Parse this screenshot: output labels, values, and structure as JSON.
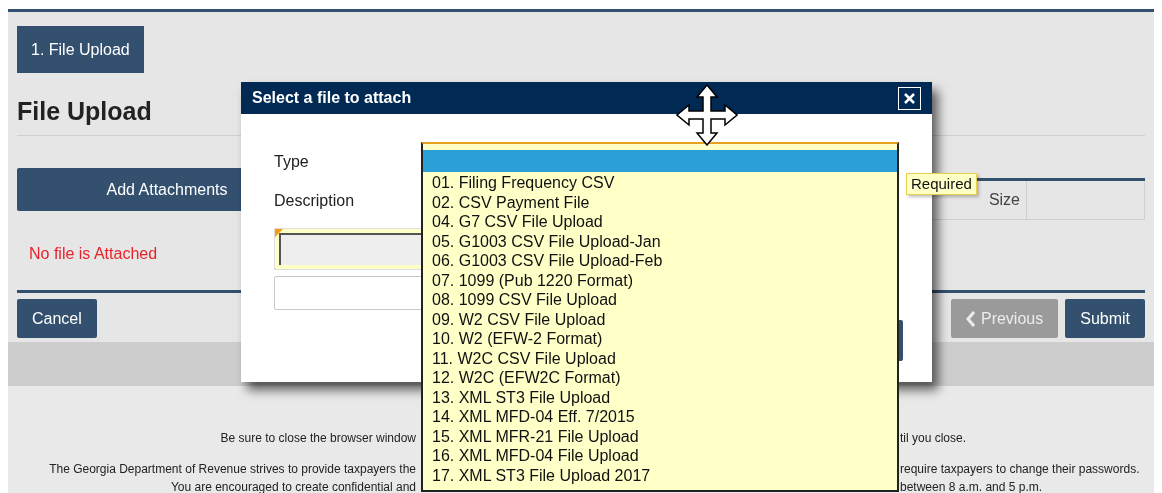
{
  "steps": [
    {
      "label": "1. File Upload",
      "selected": true
    }
  ],
  "page": {
    "heading": "File Upload",
    "add_button": "Add Attachments",
    "table": {
      "columns": [
        "Size"
      ]
    },
    "empty_message": "No file is Attached"
  },
  "buttons": [
    {
      "label": "Cancel",
      "kind": "plain",
      "disabled": false
    },
    {
      "label": "Previous",
      "kind": "back",
      "disabled": true
    },
    {
      "label": "Submit",
      "kind": "plain",
      "disabled": false
    }
  ],
  "footer": [
    {
      "left": "Be sure to close the browser window",
      "right": "til you close."
    },
    {
      "left": "The Georgia Department of Revenue strives to provide taxpayers the",
      "right": "require taxpayers to change their passwords."
    },
    {
      "left": "You are encouraged to create confidential and",
      "right": "between 8 a.m. and 5 p.m."
    }
  ],
  "dialog": {
    "title": "Select a file to attach",
    "fields": [
      {
        "label": "Type"
      },
      {
        "label": "Description"
      }
    ],
    "type_dropdown": {
      "tooltip": "Required",
      "options": [
        {
          "selected": true
        },
        {
          "label": "01. Filing Frequency CSV",
          "selected": false
        },
        {
          "label": "02. CSV Payment File",
          "selected": false
        },
        {
          "label": "04. G7 CSV File Upload",
          "selected": false
        },
        {
          "label": "05. G1003 CSV File Upload-Jan",
          "selected": false
        },
        {
          "label": "06. G1003 CSV File Upload-Feb",
          "selected": false
        },
        {
          "label": "07. 1099 (Pub 1220 Format)",
          "selected": false
        },
        {
          "label": "08. 1099 CSV File Upload",
          "selected": false
        },
        {
          "label": "09. W2 CSV File Upload",
          "selected": false
        },
        {
          "label": "10. W2 (EFW-2 Format)",
          "selected": false
        },
        {
          "label": "11. W2C CSV File Upload",
          "selected": false
        },
        {
          "label": "12. W2C (EFW2C Format)",
          "selected": false
        },
        {
          "label": "13. XML ST3 File Upload",
          "selected": false
        },
        {
          "label": "14. XML MFD-04 Eff. 7/2015",
          "selected": false
        },
        {
          "label": "15. XML MFR-21 File Upload",
          "selected": false
        },
        {
          "label": "16. XML MFD-04 File Upload",
          "selected": false
        },
        {
          "label": "17. XML ST3 File Upload 2017",
          "selected": false
        }
      ]
    }
  }
}
